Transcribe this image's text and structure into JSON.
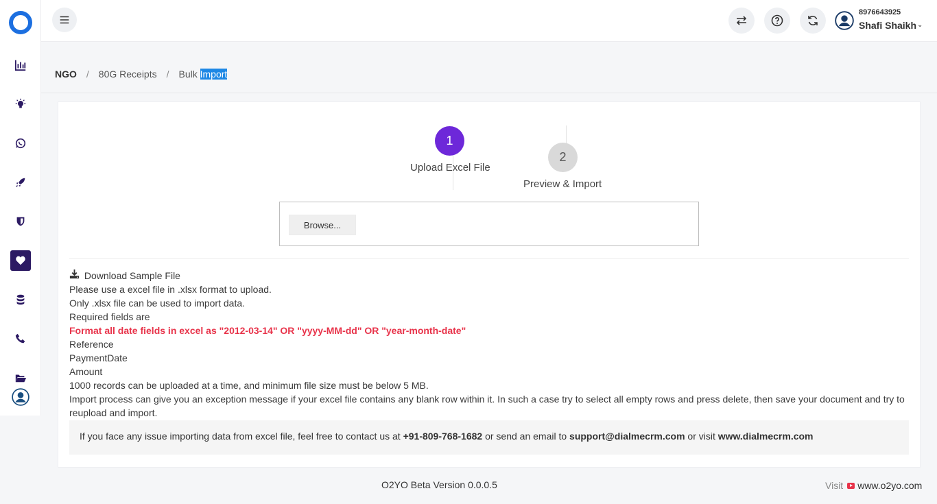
{
  "sidebar": {
    "items": [
      {
        "icon": "bar-chart-icon"
      },
      {
        "icon": "lightbulb-icon"
      },
      {
        "icon": "whatsapp-icon"
      },
      {
        "icon": "rocket-icon"
      },
      {
        "icon": "shield-icon"
      },
      {
        "icon": "heart-icon",
        "active": true
      },
      {
        "icon": "database-icon"
      },
      {
        "icon": "phone-icon"
      },
      {
        "icon": "folder-open-icon"
      }
    ]
  },
  "header": {
    "user": {
      "phone": "8976643925",
      "name": "Shafi Shaikh"
    }
  },
  "breadcrumb": {
    "items": [
      "NGO",
      "80G Receipts",
      "Bulk"
    ],
    "highlighted": "Import",
    "separator": "/"
  },
  "steps": [
    {
      "number": "1",
      "label": "Upload Excel File",
      "active": true
    },
    {
      "number": "2",
      "label": "Preview & Import",
      "active": false
    }
  ],
  "file_input": {
    "button_label": "Browse..."
  },
  "info": {
    "download_label": "Download Sample File",
    "lines": [
      "Please use a excel file in .xlsx format to upload.",
      "Only .xlsx file can be used to import data.",
      "Required fields are"
    ],
    "warning": "Format all date fields in excel as \"2012-03-14\" OR \"yyyy-MM-dd\" OR \"year-month-date\"",
    "required_fields": [
      "Reference",
      "PaymentDate",
      "Amount"
    ],
    "notes": [
      "1000 records can be uploaded at a time, and minimum file size must be below 5 MB.",
      "Import process can give you an exception message if your excel file contains any blank row within it. In such a case try to select all empty rows and press delete, then save your document and try to reupload and import."
    ]
  },
  "contact": {
    "text1": "If you face any issue importing data from excel file, feel free to contact us at ",
    "phone": "+91-809-768-1682",
    "text2": " or send an email to ",
    "email": "support@dialmecrm.com",
    "text3": " or visit ",
    "website": "www.dialmecrm.com"
  },
  "footer": {
    "version": "O2YO Beta Version 0.0.0.5",
    "visit_label": "Visit",
    "visit_url": "www.o2yo.com"
  },
  "colors": {
    "accent": "#6d28d9",
    "sidebar_active": "#2c1a63",
    "warning": "#e8334a",
    "logo": "#1c6fe0"
  }
}
